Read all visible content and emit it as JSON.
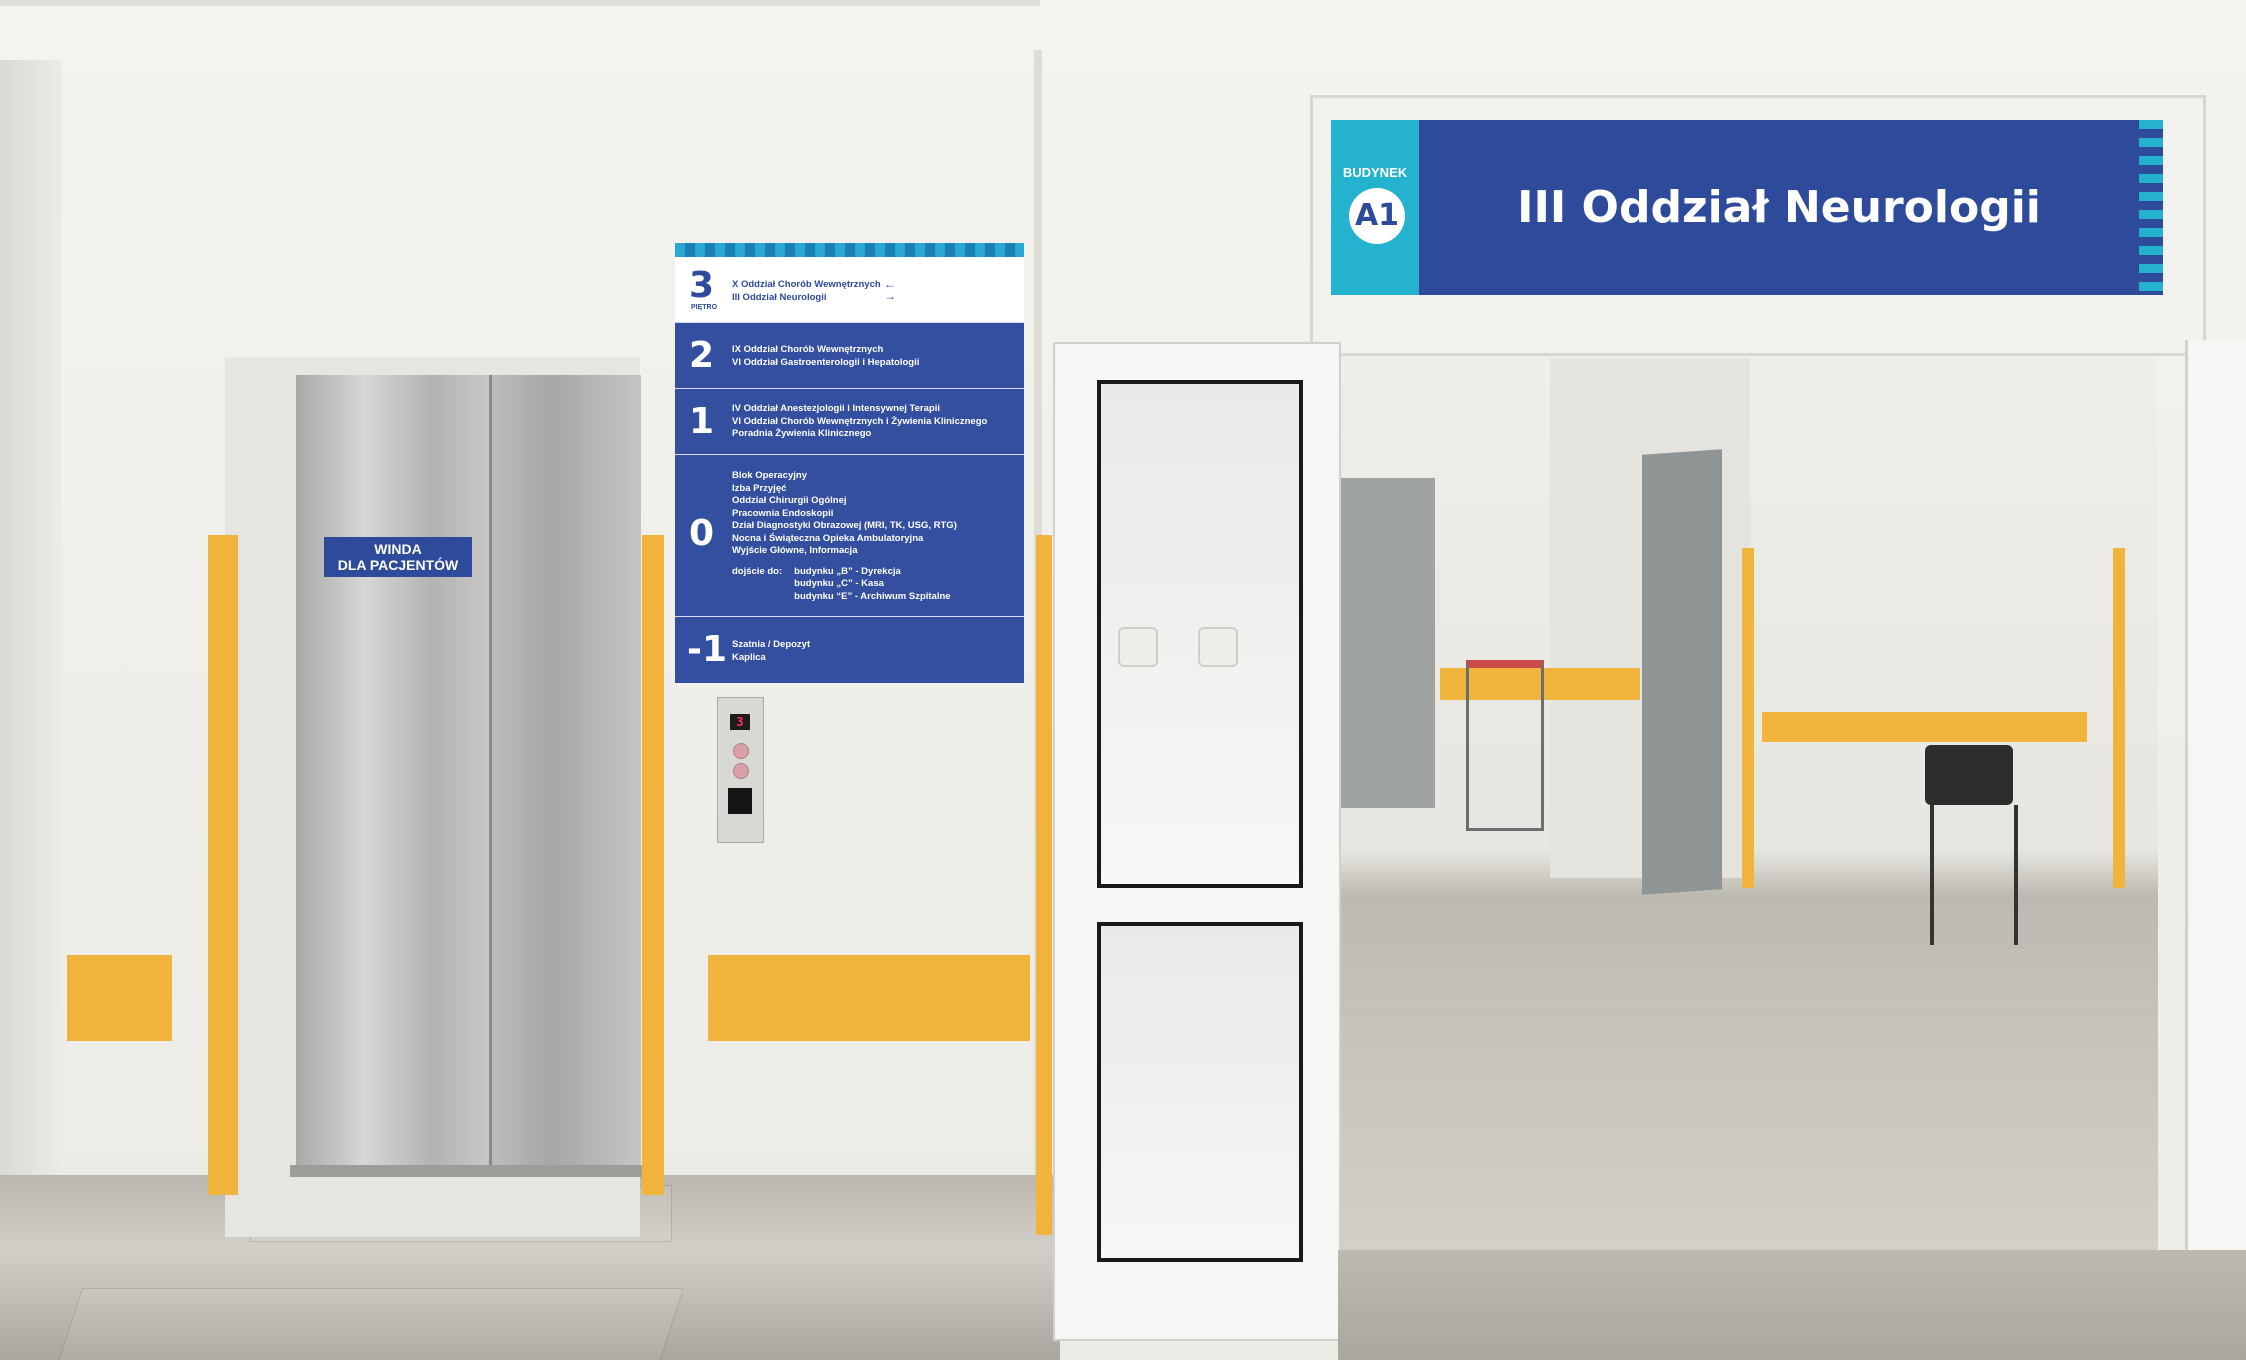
{
  "directory": {
    "floors": [
      {
        "number": "3",
        "sublabel": "PIĘTRO",
        "entries": [
          "X Oddział Chorób Wewnętrznych",
          "III Oddział Neurologii"
        ],
        "arrows": [
          "←",
          "→"
        ]
      },
      {
        "number": "2",
        "entries": [
          "IX Oddział Chorób Wewnętrznych",
          "VI Oddział Gastroenterologii i Hepatologii"
        ]
      },
      {
        "number": "1",
        "entries": [
          "IV Oddział Anestezjologii i Intensywnej Terapii",
          "VI Oddział Chorób Wewnętrznych i Żywienia Klinicznego",
          "Poradnia Żywienia Klinicznego"
        ]
      },
      {
        "number": "0",
        "entries": [
          "Blok Operacyjny",
          "Izba Przyjęć",
          "Oddział Chirurgii Ogólnej",
          "Pracownia Endoskopii",
          "Dział Diagnostyki Obrazowej (MRI, TK, USG, RTG)",
          "Nocna i Świąteczna Opieka Ambulatoryjna",
          "Wyjście Główne, Informacja"
        ],
        "access_label": "dojście do:",
        "access": [
          "budynku „B” - Dyrekcja",
          "budynku „C” - Kasa",
          "budynku “E” - Archiwum Szpitalne"
        ]
      },
      {
        "number": "-1",
        "entries": [
          "Szatnia / Depozyt",
          "Kaplica"
        ]
      }
    ]
  },
  "header_sign": {
    "building_label": "BUDYNEK",
    "building_code": "A1",
    "ward_name": "III Oddział Neurologii"
  },
  "elevator": {
    "label_line1": "WINDA",
    "label_line2": "DLA PACJENTÓW",
    "floor_display": "3"
  },
  "colors": {
    "sign_blue": "#2e4a9b",
    "sign_cyan": "#24b2cf",
    "wall_accent_orange": "#f0b43c"
  }
}
